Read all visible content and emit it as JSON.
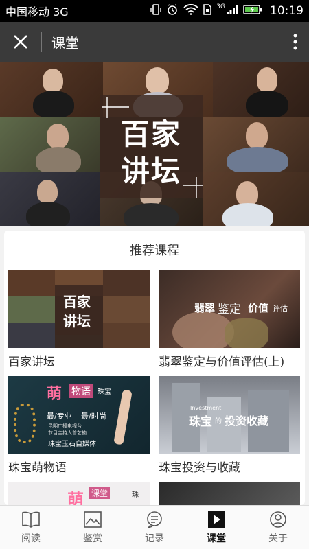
{
  "status": {
    "carrier": "中国移动 3G",
    "network": "3G",
    "time": "10:19"
  },
  "nav": {
    "title": "课堂"
  },
  "banner": {
    "logo_line1": "百家",
    "logo_line2": "讲坛"
  },
  "recommend": {
    "title": "推荐课程",
    "courses": [
      {
        "label": "百家讲坛",
        "thumb_text": [
          "百家",
          "讲坛"
        ]
      },
      {
        "label": "翡翠鉴定与价值评估(上)",
        "thumb_text": [
          "翡翠",
          "鉴定",
          "价值",
          "评估"
        ]
      },
      {
        "label": "珠宝萌物语",
        "thumb_text": [
          "萌",
          "物语",
          "珠宝",
          "最/专业",
          "最/时尚",
          "昆明广播电视台",
          "节目主持人曾艺楠",
          "珠宝玉石自媒体"
        ]
      },
      {
        "label": "珠宝投资与收藏",
        "thumb_text": [
          "珠宝",
          "的",
          "投资收藏",
          "Investment"
        ]
      }
    ],
    "partial": [
      {
        "thumb_text": [
          "萌",
          "课堂",
          "珠"
        ]
      }
    ]
  },
  "tabs": [
    {
      "label": "阅读",
      "icon": "book-icon"
    },
    {
      "label": "鉴赏",
      "icon": "image-icon"
    },
    {
      "label": "记录",
      "icon": "chat-list-icon"
    },
    {
      "label": "课堂",
      "icon": "play-icon",
      "active": true
    },
    {
      "label": "关于",
      "icon": "user-icon"
    }
  ]
}
